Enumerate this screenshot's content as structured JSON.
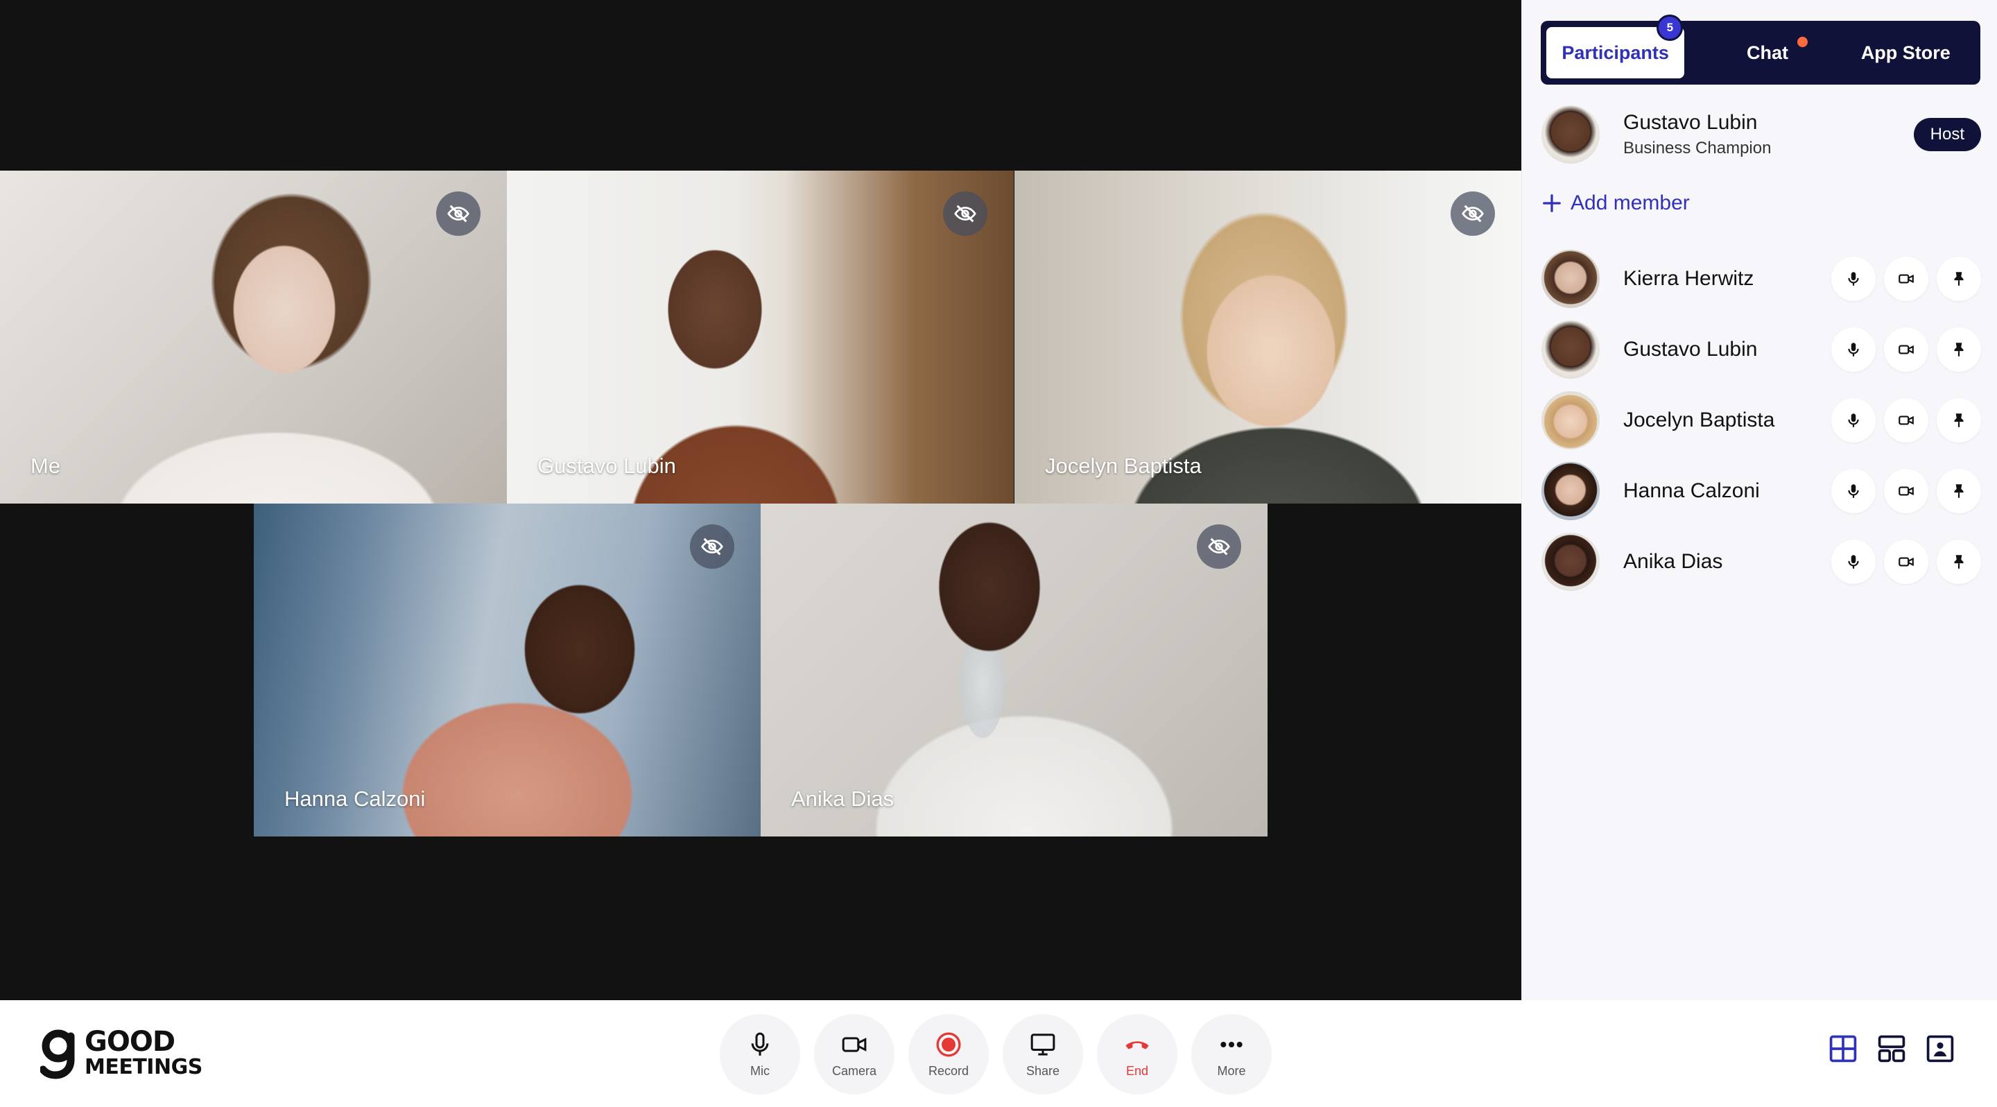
{
  "participants_tiles": [
    {
      "name": "Me"
    },
    {
      "name": "Gustavo Lubin"
    },
    {
      "name": "Jocelyn Baptista"
    },
    {
      "name": "Hanna Calzoni"
    },
    {
      "name": "Anika Dias"
    }
  ],
  "sidebar": {
    "tabs": {
      "participants": "Participants",
      "participants_count": "5",
      "chat": "Chat",
      "app_store": "App Store"
    },
    "host": {
      "name": "Gustavo Lubin",
      "role": "Business Champion",
      "badge": "Host"
    },
    "add_member": "Add member",
    "members": [
      {
        "name": "Kierra Herwitz"
      },
      {
        "name": "Gustavo Lubin"
      },
      {
        "name": "Jocelyn Baptista"
      },
      {
        "name": "Hanna Calzoni"
      },
      {
        "name": "Anika Dias"
      }
    ]
  },
  "logo": {
    "line1": "GOOD",
    "line2": "MEETINGS"
  },
  "controls": {
    "mic": "Mic",
    "camera": "Camera",
    "record": "Record",
    "share": "Share",
    "end": "End",
    "more": "More"
  },
  "colors": {
    "accent": "#3130b8",
    "navy": "#10123a",
    "record": "#e53935",
    "chat_dot": "#ff6a3d"
  }
}
